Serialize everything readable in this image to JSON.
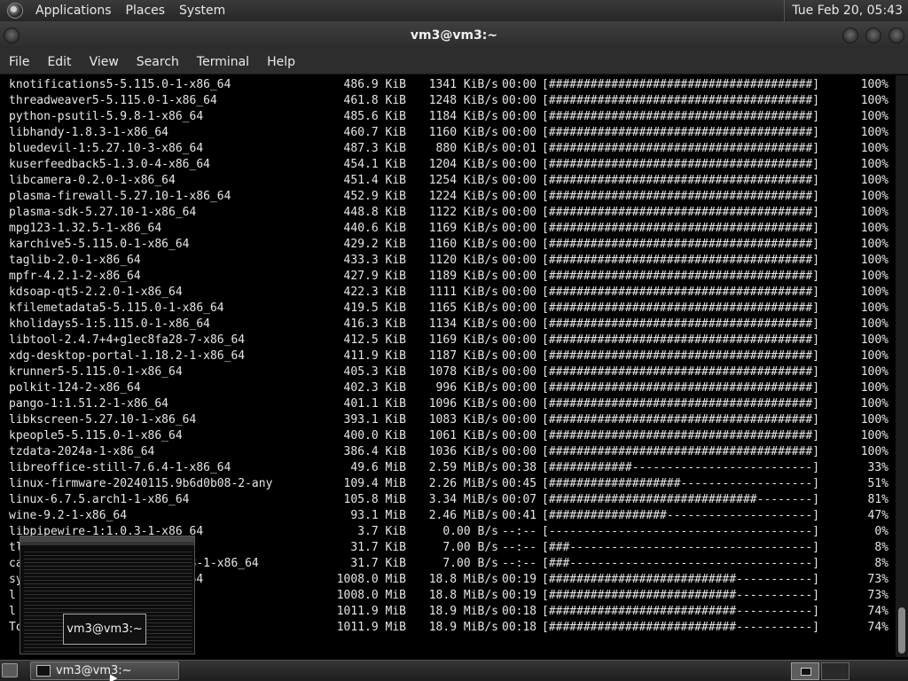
{
  "top_panel": {
    "menus": [
      "Applications",
      "Places",
      "System"
    ],
    "clock": "Tue Feb 20, 05:43"
  },
  "window": {
    "title": "vm3@vm3:~"
  },
  "menubar": {
    "items": [
      "File",
      "Edit",
      "View",
      "Search",
      "Terminal",
      "Help"
    ]
  },
  "terminal": {
    "rows": [
      {
        "name": "knotifications5-5.115.0-1-x86_64",
        "size": "486.9 KiB",
        "rate": "1341 KiB/s",
        "time": "00:00",
        "bar": "[######################################]",
        "pct": "100%"
      },
      {
        "name": "threadweaver5-5.115.0-1-x86_64",
        "size": "461.8 KiB",
        "rate": "1248 KiB/s",
        "time": "00:00",
        "bar": "[######################################]",
        "pct": "100%"
      },
      {
        "name": "python-psutil-5.9.8-1-x86_64",
        "size": "485.6 KiB",
        "rate": "1184 KiB/s",
        "time": "00:00",
        "bar": "[######################################]",
        "pct": "100%"
      },
      {
        "name": "libhandy-1.8.3-1-x86_64",
        "size": "460.7 KiB",
        "rate": "1160 KiB/s",
        "time": "00:00",
        "bar": "[######################################]",
        "pct": "100%"
      },
      {
        "name": "bluedevil-1:5.27.10-3-x86_64",
        "size": "487.3 KiB",
        "rate": "880 KiB/s",
        "time": "00:01",
        "bar": "[######################################]",
        "pct": "100%"
      },
      {
        "name": "kuserfeedback5-1.3.0-4-x86_64",
        "size": "454.1 KiB",
        "rate": "1204 KiB/s",
        "time": "00:00",
        "bar": "[######################################]",
        "pct": "100%"
      },
      {
        "name": "libcamera-0.2.0-1-x86_64",
        "size": "451.4 KiB",
        "rate": "1254 KiB/s",
        "time": "00:00",
        "bar": "[######################################]",
        "pct": "100%"
      },
      {
        "name": "plasma-firewall-5.27.10-1-x86_64",
        "size": "452.9 KiB",
        "rate": "1224 KiB/s",
        "time": "00:00",
        "bar": "[######################################]",
        "pct": "100%"
      },
      {
        "name": "plasma-sdk-5.27.10-1-x86_64",
        "size": "448.8 KiB",
        "rate": "1122 KiB/s",
        "time": "00:00",
        "bar": "[######################################]",
        "pct": "100%"
      },
      {
        "name": "mpg123-1.32.5-1-x86_64",
        "size": "440.6 KiB",
        "rate": "1169 KiB/s",
        "time": "00:00",
        "bar": "[######################################]",
        "pct": "100%"
      },
      {
        "name": "karchive5-5.115.0-1-x86_64",
        "size": "429.2 KiB",
        "rate": "1160 KiB/s",
        "time": "00:00",
        "bar": "[######################################]",
        "pct": "100%"
      },
      {
        "name": "taglib-2.0-1-x86_64",
        "size": "433.3 KiB",
        "rate": "1120 KiB/s",
        "time": "00:00",
        "bar": "[######################################]",
        "pct": "100%"
      },
      {
        "name": "mpfr-4.2.1-2-x86_64",
        "size": "427.9 KiB",
        "rate": "1189 KiB/s",
        "time": "00:00",
        "bar": "[######################################]",
        "pct": "100%"
      },
      {
        "name": "kdsoap-qt5-2.2.0-1-x86_64",
        "size": "422.3 KiB",
        "rate": "1111 KiB/s",
        "time": "00:00",
        "bar": "[######################################]",
        "pct": "100%"
      },
      {
        "name": "kfilemetadata5-5.115.0-1-x86_64",
        "size": "419.5 KiB",
        "rate": "1165 KiB/s",
        "time": "00:00",
        "bar": "[######################################]",
        "pct": "100%"
      },
      {
        "name": "kholidays5-1:5.115.0-1-x86_64",
        "size": "416.3 KiB",
        "rate": "1134 KiB/s",
        "time": "00:00",
        "bar": "[######################################]",
        "pct": "100%"
      },
      {
        "name": "libtool-2.4.7+4+g1ec8fa28-7-x86_64",
        "size": "412.5 KiB",
        "rate": "1169 KiB/s",
        "time": "00:00",
        "bar": "[######################################]",
        "pct": "100%"
      },
      {
        "name": "xdg-desktop-portal-1.18.2-1-x86_64",
        "size": "411.9 KiB",
        "rate": "1187 KiB/s",
        "time": "00:00",
        "bar": "[######################################]",
        "pct": "100%"
      },
      {
        "name": "krunner5-5.115.0-1-x86_64",
        "size": "405.3 KiB",
        "rate": "1078 KiB/s",
        "time": "00:00",
        "bar": "[######################################]",
        "pct": "100%"
      },
      {
        "name": "polkit-124-2-x86_64",
        "size": "402.3 KiB",
        "rate": "996 KiB/s",
        "time": "00:00",
        "bar": "[######################################]",
        "pct": "100%"
      },
      {
        "name": "pango-1:1.51.2-1-x86_64",
        "size": "401.1 KiB",
        "rate": "1096 KiB/s",
        "time": "00:00",
        "bar": "[######################################]",
        "pct": "100%"
      },
      {
        "name": "libkscreen-5.27.10-1-x86_64",
        "size": "393.1 KiB",
        "rate": "1083 KiB/s",
        "time": "00:00",
        "bar": "[######################################]",
        "pct": "100%"
      },
      {
        "name": "kpeople5-5.115.0-1-x86_64",
        "size": "400.0 KiB",
        "rate": "1061 KiB/s",
        "time": "00:00",
        "bar": "[######################################]",
        "pct": "100%"
      },
      {
        "name": "tzdata-2024a-1-x86_64",
        "size": "386.4 KiB",
        "rate": "1036 KiB/s",
        "time": "00:00",
        "bar": "[######################################]",
        "pct": "100%"
      },
      {
        "name": "libreoffice-still-7.6.4-1-x86_64",
        "size": "49.6 MiB",
        "rate": "2.59 MiB/s",
        "time": "00:38",
        "bar": "[############--------------------------]",
        "pct": "33%"
      },
      {
        "name": "linux-firmware-20240115.9b6d0b08-2-any",
        "size": "109.4 MiB",
        "rate": "2.26 MiB/s",
        "time": "00:45",
        "bar": "[###################-------------------]",
        "pct": "51%"
      },
      {
        "name": "linux-6.7.5.arch1-1-x86_64",
        "size": "105.8 MiB",
        "rate": "3.34 MiB/s",
        "time": "00:07",
        "bar": "[##############################--------]",
        "pct": "81%"
      },
      {
        "name": "wine-9.2-1-x86_64",
        "size": "93.1 MiB",
        "rate": "2.46 MiB/s",
        "time": "00:41",
        "bar": "[#################---------------------]",
        "pct": "47%"
      },
      {
        "name": "libpipewire-1:1.0.3-1-x86_64",
        "size": "3.7 KiB",
        "rate": "0.00 B/s",
        "time": "--:--",
        "bar": "[--------------------------------------]",
        "pct": "0%"
      },
      {
        "name": "tl",
        "size": "31.7 KiB",
        "rate": "7.00 B/s",
        "time": "--:--",
        "bar": "[###-----------------------------------]",
        "pct": "8%"
      },
      {
        "name": "ca                       08-1-x86_64",
        "size": "31.7 KiB",
        "rate": "7.00 B/s",
        "time": "--:--",
        "bar": "[###-----------------------------------]",
        "pct": "8%"
      },
      {
        "name": "sy                     86_64",
        "size": "1008.0 MiB",
        "rate": "18.8 MiB/s",
        "time": "00:19",
        "bar": "[###########################-----------]",
        "pct": "73%"
      },
      {
        "name": "l",
        "size": "1008.0 MiB",
        "rate": "18.8 MiB/s",
        "time": "00:19",
        "bar": "[###########################-----------]",
        "pct": "73%"
      },
      {
        "name": "l",
        "size": "1011.9 MiB",
        "rate": "18.9 MiB/s",
        "time": "00:18",
        "bar": "[###########################-----------]",
        "pct": "74%"
      },
      {
        "name": "To",
        "size": "1011.9 MiB",
        "rate": "18.9 MiB/s",
        "time": "00:18",
        "bar": "[###########################-----------]",
        "pct": "74%"
      }
    ]
  },
  "tooltip": {
    "text": "vm3@vm3:~"
  },
  "taskbar": {
    "task_label": "vm3@vm3:~"
  },
  "colors": {
    "panel_bg": "#2d2d2d",
    "terminal_bg": "#000000",
    "terminal_fg": "#e6e6e6"
  }
}
